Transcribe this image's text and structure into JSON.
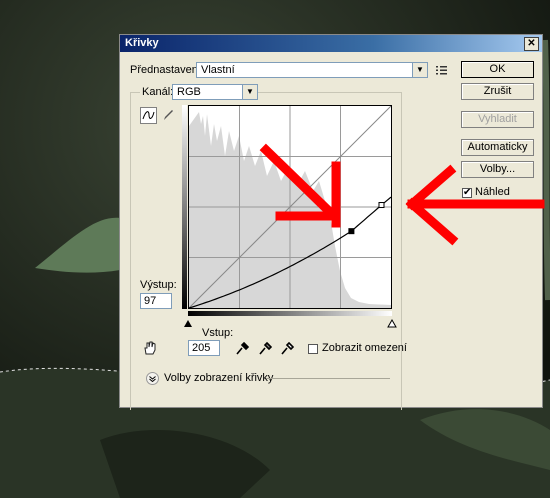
{
  "dialog": {
    "title": "Křivky",
    "close_glyph": "✕",
    "preset_label": "Přednastavení:",
    "preset_value": "Vlastní",
    "channel_label": "Kanál:",
    "channel_value": "RGB",
    "output_label": "Výstup:",
    "output_value": "97",
    "input_label": "Vstup:",
    "input_value": "205",
    "show_clipping_label": "Zobrazit omezení",
    "show_clipping_checked": false,
    "display_options_label": "Volby zobrazení křivky",
    "buttons": {
      "ok": "OK",
      "cancel": "Zrušit",
      "smooth": "Vyhladit",
      "auto": "Automaticky",
      "options": "Volby..."
    },
    "preview_label": "Náhled",
    "preview_checked": true
  },
  "icons": {
    "curve_tool": "curve-icon",
    "pencil_tool": "pencil-icon",
    "preset_menu": "menu-icon",
    "hand_tool": "hand-icon",
    "black_eyedropper": "eyedropper-icon",
    "gray_eyedropper": "eyedropper-icon",
    "white_eyedropper": "eyedropper-icon",
    "expand": "chevron-down-icon"
  },
  "curve_points": [
    {
      "input": 0,
      "output": 0
    },
    {
      "input": 205,
      "output": 97
    },
    {
      "input": 243,
      "output": 130
    },
    {
      "input": 255,
      "output": 140
    }
  ],
  "annotation_color": "#ff0000"
}
